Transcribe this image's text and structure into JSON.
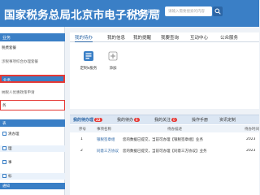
{
  "header": {
    "title": "国家税务总局北京市电子税务局",
    "status": "无障碍阅读",
    "search_placeholder": "请输入需要搜索的内容"
  },
  "sidebar": {
    "section_title": "业务",
    "items": [
      {
        "label": "税费套餐"
      },
      {
        "label": "涉税事项综合办理套餐"
      },
      {
        "label": "业务"
      },
      {
        "label": "纳税人优惠政策申请"
      },
      {
        "label": "务"
      }
    ],
    "list_title": "表",
    "list_rows": [
      {
        "label": "清办理"
      },
      {
        "label": "理"
      },
      {
        "label": "事"
      },
      {
        "label": "标"
      }
    ],
    "bottom_label": "通知"
  },
  "main_tabs": [
    {
      "label": "我的待办"
    },
    {
      "label": "我的信息"
    },
    {
      "label": "我的提醒"
    },
    {
      "label": "我要查询"
    },
    {
      "label": "互动中心"
    },
    {
      "label": "公众服务"
    }
  ],
  "tiles": [
    {
      "label": "定制e服务",
      "icon": "task-icon"
    },
    {
      "label": "添加",
      "icon": "add-icon"
    }
  ],
  "task_tabs": [
    {
      "label": "我的待办理",
      "badge": "22"
    },
    {
      "label": "我的待办",
      "badge": "8"
    },
    {
      "label": "我的关注",
      "badge": "0"
    },
    {
      "label": "操作手册",
      "badge": ""
    },
    {
      "label": "资讯定制",
      "badge": ""
    }
  ],
  "table": {
    "columns": [
      "序号",
      "事项名称",
      "待办描述",
      "待办时间"
    ],
    "rows": [
      {
        "no": "1",
        "name": "银税签章组",
        "desc": "您的数据已提交，当前可办理【银税签章组】业务",
        "time": "2023"
      },
      {
        "no": "2",
        "name": "同意三方协议",
        "desc": "您的数据已提交，当前可办理【同意三方协议】业务",
        "time": "2023"
      }
    ]
  },
  "colors": {
    "header_blue": "#3a7fc6",
    "highlight_red": "#e53935",
    "badge_red": "#e53935"
  }
}
